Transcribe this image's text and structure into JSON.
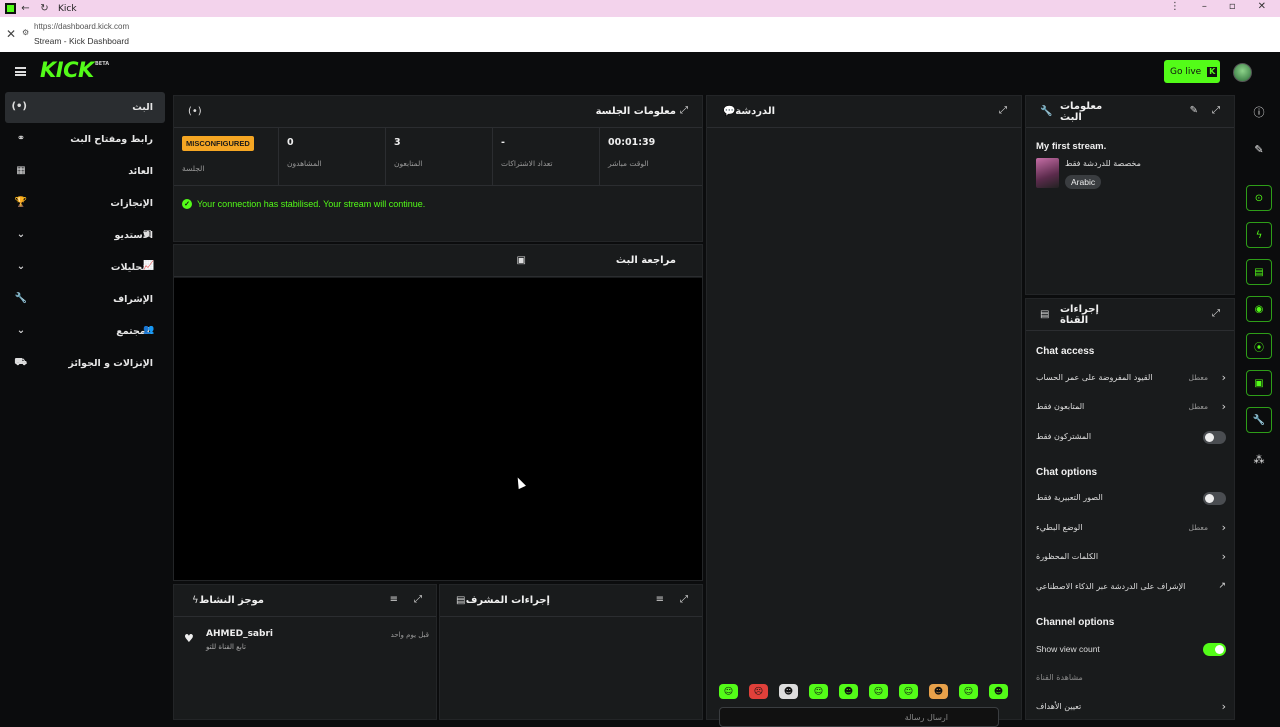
{
  "browser": {
    "tab_title": "Kick",
    "url": "https://dashboard.kick.com",
    "page_title": "Stream - Kick Dashboard"
  },
  "topnav": {
    "logo": "KICK",
    "beta": "BETA",
    "go_live": "Go live",
    "go_live_k": "K"
  },
  "sidebar": {
    "items": [
      {
        "label": "البث",
        "icon": "(•)"
      },
      {
        "label": "رابط ومفتاح البث",
        "icon": "⚭"
      },
      {
        "label": "العائد",
        "icon": "▦"
      },
      {
        "label": "الإنجازات",
        "icon": "🏆"
      },
      {
        "label": "الاستديو",
        "icon": "▣"
      },
      {
        "label": "التحليلات",
        "icon": "📈"
      },
      {
        "label": "الإشراف",
        "icon": "🔧"
      },
      {
        "label": "المجتمع",
        "icon": "👥"
      },
      {
        "label": "الإنزالات و الجوائز",
        "icon": "⛟"
      }
    ]
  },
  "session": {
    "title": "معلومات الجلسة",
    "status_badge": "MISCONFIGURED",
    "status_label": "الجلسة",
    "viewers": "0",
    "viewers_label": "المشاهدون",
    "followers": "3",
    "followers_label": "المتابعون",
    "subs": "-",
    "subs_label": "تعداد الاشتراكات",
    "uptime": "00:01:39",
    "uptime_label": "الوقت مباشر",
    "message": "Your connection has stabilised. Your stream will continue.",
    "ok_mark": "✓"
  },
  "preview": {
    "title": "مراجعة البث"
  },
  "activity": {
    "title": "موجز النشاط",
    "items": [
      {
        "user": "AHMED_sabri",
        "sub": "تابع القناة للتو",
        "time": "قبل يوم واحد"
      }
    ]
  },
  "mod_actions": {
    "title": "إجراءات المشرف"
  },
  "chat": {
    "title": "الدردشة",
    "placeholder": "ارسال رسالة"
  },
  "stream_info": {
    "title": "معلومات البث",
    "stream_title": "My first stream.",
    "category": "مخصصة للدردشة فقط",
    "tag": "Arabic"
  },
  "channel_actions": {
    "title": "إجراءات القناة",
    "chat_access_title": "Chat access",
    "chat_options_title": "Chat options",
    "channel_options_title": "Channel options",
    "opt_account_age": "القيود المفروضة على عمر الحساب",
    "opt_account_age_val": "معطل",
    "opt_followers_only": "المتابعون فقط",
    "opt_followers_only_val": "معطل",
    "opt_subs_only": "المشتركون فقط",
    "opt_emotes_only": "الصور التعبيرية فقط",
    "opt_slow_mode": "الوضع البطيء",
    "opt_slow_mode_val": "معطل",
    "opt_banned_words": "الكلمات المحظورة",
    "opt_ai_mod": "الإشراف على الدردشة عبر الذكاء الاصطناعي",
    "opt_show_view_count": "Show view count",
    "opt_share": "مشاهدة القناة",
    "opt_goals": "تعيين الأهداف"
  }
}
